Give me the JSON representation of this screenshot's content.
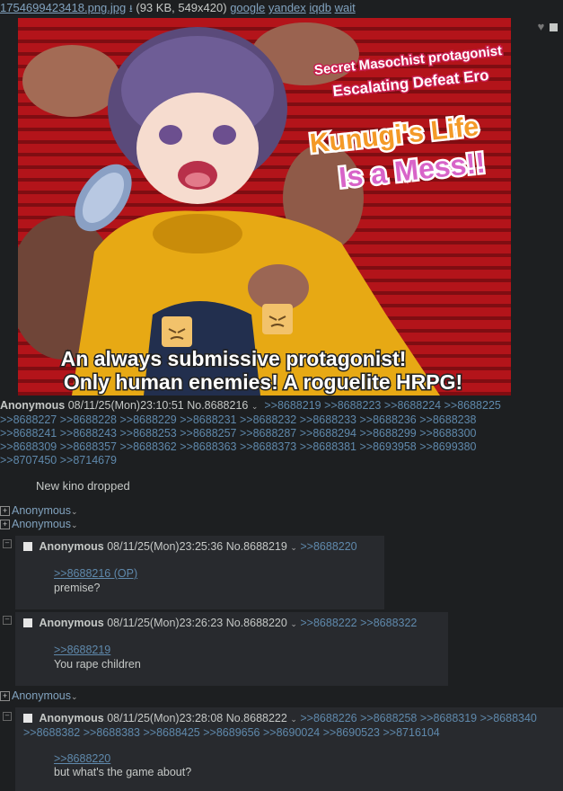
{
  "file": {
    "name": "1754699423418.png.jpg",
    "meta": "(93 KB, 549x420)",
    "links": [
      "google",
      "yandex",
      "iqdb",
      "wait"
    ]
  },
  "image": {
    "tagline1": "Secret Masochist protagonist",
    "tagline2": "Escalating Defeat Ero",
    "title1": "Kunugi's Life",
    "title2": "Is a Mess!!",
    "bottom1": "An always submissive protagonist!",
    "bottom2": "Only human enemies! A roguelite HRPG!"
  },
  "op": {
    "name": "Anonymous",
    "datetime": "08/11/25(Mon)23:10:51",
    "no": "No.8688216",
    "backlinks": [
      ">>8688219",
      ">>8688223",
      ">>8688224",
      ">>8688225",
      ">>8688227",
      ">>8688228",
      ">>8688229",
      ">>8688231",
      ">>8688232",
      ">>8688233",
      ">>8688236",
      ">>8688238",
      ">>8688241",
      ">>8688243",
      ">>8688253",
      ">>8688257",
      ">>8688287",
      ">>8688294",
      ">>8688299",
      ">>8688300",
      ">>8688309",
      ">>8688357",
      ">>8688362",
      ">>8688363",
      ">>8688373",
      ">>8688381",
      ">>8693958",
      ">>8699380",
      ">>8707450",
      ">>8714679"
    ],
    "text": "New kino dropped"
  },
  "hidden": [
    "Anonymous",
    "Anonymous",
    "Anonymous"
  ],
  "replies": [
    {
      "name": "Anonymous",
      "datetime": "08/11/25(Mon)23:25:36",
      "no": "No.8688219",
      "backlinks": [
        ">>8688220"
      ],
      "quote": ">>8688216 (OP)",
      "text": "premise?"
    },
    {
      "name": "Anonymous",
      "datetime": "08/11/25(Mon)23:26:23",
      "no": "No.8688220",
      "backlinks": [
        ">>8688222",
        ">>8688322"
      ],
      "quote": ">>8688219",
      "text": "You rape children"
    },
    {
      "name": "Anonymous",
      "datetime": "08/11/25(Mon)23:28:08",
      "no": "No.8688222",
      "backlinks": [
        ">>8688226",
        ">>8688258",
        ">>8688319",
        ">>8688340",
        ">>8688382",
        ">>8688383",
        ">>8688425",
        ">>8689656",
        ">>8690024",
        ">>8690523",
        ">>8716104"
      ],
      "quote": ">>8688220",
      "text": "but what's the game about?"
    }
  ],
  "colors": {
    "background": "#1d1f21",
    "reply_bg": "#282a2e",
    "link": "#81a2be"
  }
}
